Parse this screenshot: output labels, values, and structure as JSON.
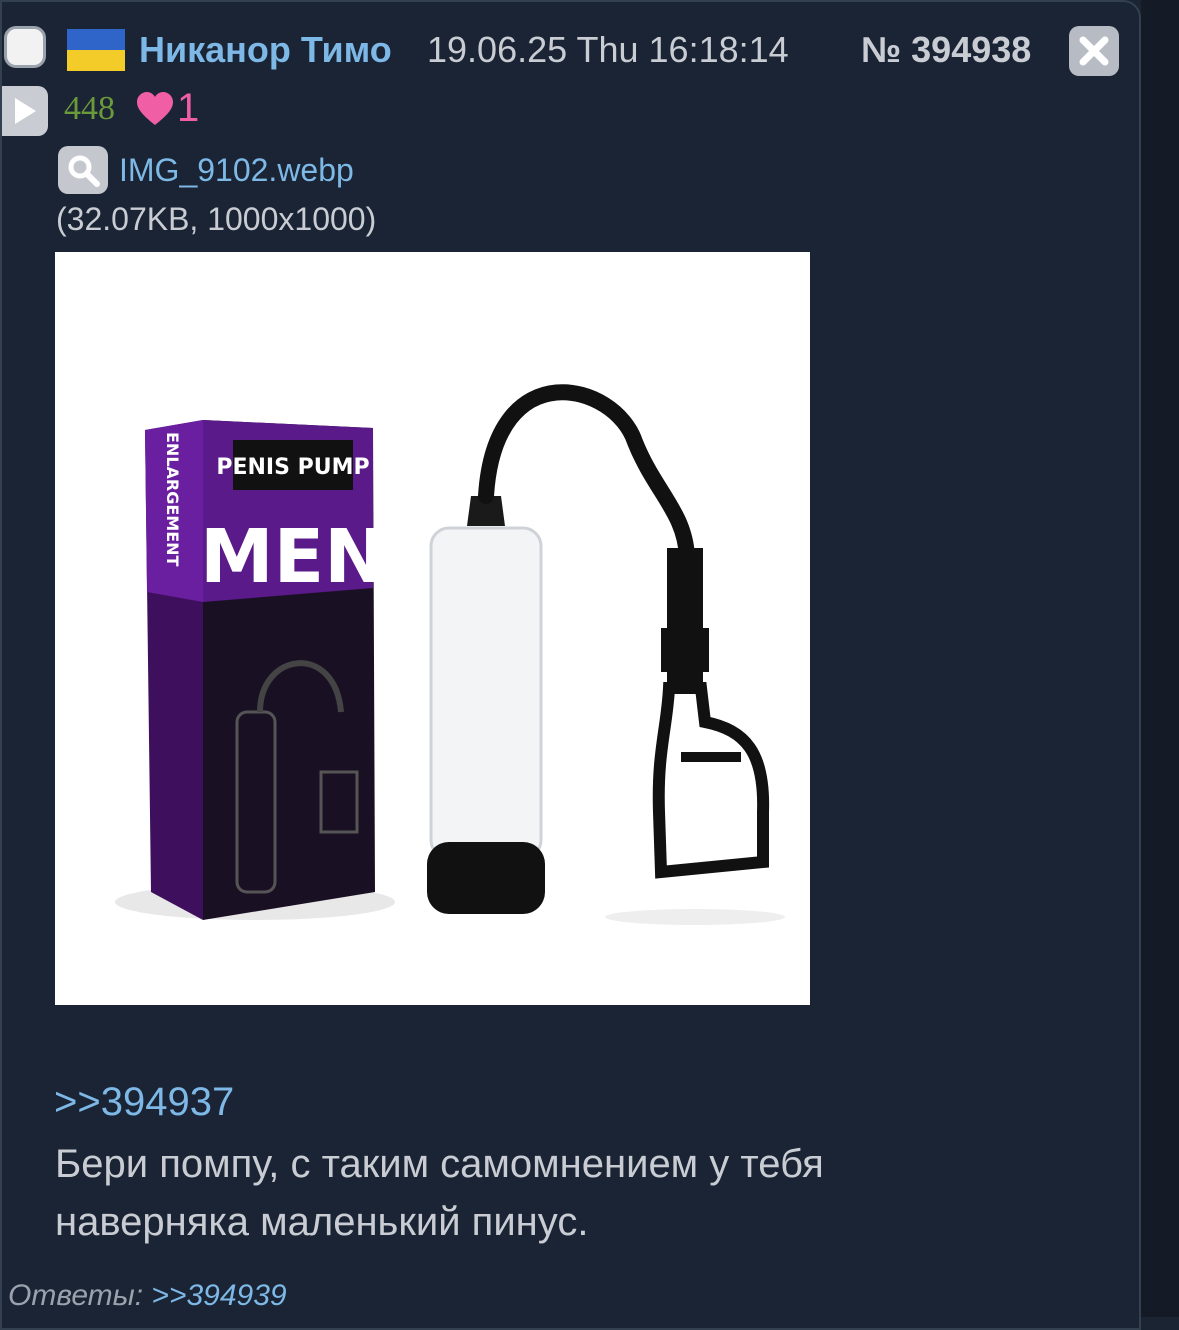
{
  "post": {
    "author": "Никанор Тимо",
    "datetime": "19.06.25 Thu 16:18:14",
    "number_prefix": "№",
    "number": "394938",
    "views": "448",
    "likes": "1",
    "flag_colors": [
      "#2f64c8",
      "#f4cc2a"
    ],
    "file": {
      "name": "IMG_9102.webp",
      "info": "(32.07KB, 1000x1000)",
      "image_texts": {
        "logo": "PENIS PUMP",
        "headline": "MEN",
        "side": "ENLARGEMENT"
      }
    },
    "reply_link": ">>394937",
    "message": "Бери помпу, с таким самомнением у тебя наверняка маленький пинус.",
    "replies_label": "Ответы:",
    "replies": [
      ">>394939"
    ]
  }
}
